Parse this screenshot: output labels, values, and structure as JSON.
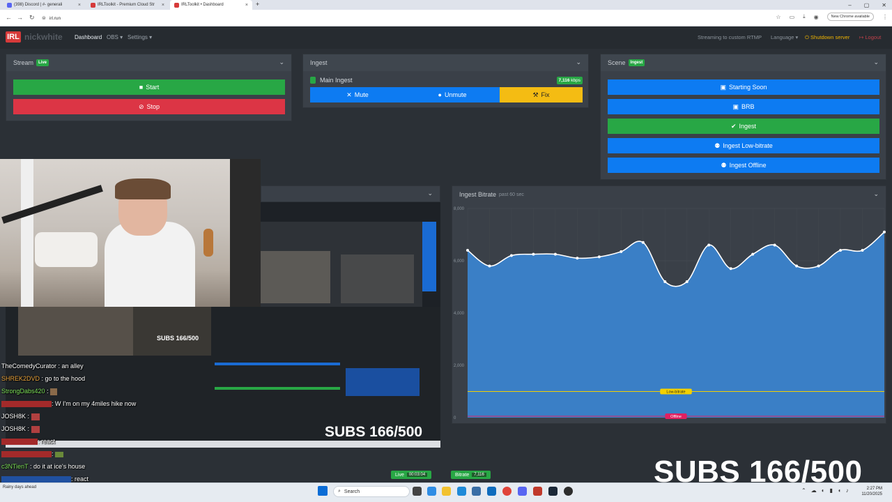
{
  "browser": {
    "tabs": [
      {
        "label": "(398) Discord | #- generali"
      },
      {
        "label": "IRLToolkit - Premium Cloud Str"
      },
      {
        "label": "IRLToolkit • Dashboard"
      }
    ],
    "url": "irl.run",
    "new_chrome": "New Chrome available"
  },
  "app": {
    "brand": "nickwhite",
    "nav": {
      "dashboard": "Dashboard",
      "obs": "OBS",
      "settings": "Settings"
    },
    "status": "Streaming to custom RTMP",
    "language": "Language",
    "shutdown": "Shutdown server",
    "logout": "Logout"
  },
  "stream": {
    "title": "Stream",
    "badge": "Live",
    "start": "Start",
    "stop": "Stop"
  },
  "ingest": {
    "title": "Ingest",
    "source": "Main Ingest",
    "bitrate": "7,116",
    "unit": "kbps",
    "mute": "Mute",
    "unmute": "Unmute",
    "fix": "Fix"
  },
  "scene": {
    "title": "Scene",
    "badge": "Ingest",
    "buttons": [
      "Starting Soon",
      "BRB",
      "Ingest",
      "Ingest Low-bitrate",
      "Ingest Offline"
    ]
  },
  "chart": {
    "title": "Ingest Bitrate",
    "subtitle": "past 60 sec",
    "low_label": "Low-bitrate",
    "offline_label": "Offline"
  },
  "chart_data": {
    "type": "area",
    "title": "Ingest Bitrate",
    "subtitle": "past 60 sec",
    "yticks": [
      "8,000",
      "6,000",
      "4,000",
      "2,000",
      "0"
    ],
    "ylim": [
      0,
      8000
    ],
    "values": [
      6400,
      5800,
      6200,
      6250,
      6250,
      6100,
      6150,
      6350,
      6700,
      5200,
      5200,
      6600,
      5700,
      6250,
      6600,
      5800,
      5800,
      6400,
      6400,
      7100
    ],
    "thresholds": [
      {
        "name": "Low-bitrate",
        "value": 1000,
        "color": "#f4d000"
      },
      {
        "name": "Offline",
        "value": 0,
        "color": "#e02060"
      }
    ],
    "grid": true
  },
  "footer": {
    "live_label": "Live",
    "live_time": "00:03:04",
    "bitrate_label": "Bitrate",
    "bitrate_value": "7,116"
  },
  "overlay": {
    "subs": "SUBS 166/500"
  },
  "chat": [
    {
      "user": "TheComedyCurator",
      "msg": ": an alley"
    },
    {
      "user": "SHREK2DVD",
      "msg": ": go to the hood"
    },
    {
      "user": "StrongDabs420",
      "msg": ":"
    },
    {
      "user": "",
      "msg": ": W I'm on my 4miles hike now"
    },
    {
      "user": "JOSH8K",
      "msg": ":"
    },
    {
      "user": "JOSH8K",
      "msg": ":"
    },
    {
      "user": "",
      "msg": ": react"
    },
    {
      "user": "",
      "msg": ":"
    },
    {
      "user": "c3NTienT",
      "msg": ": do it at ice's house"
    },
    {
      "user": "",
      "msg": ": react"
    }
  ],
  "taskbar": {
    "search": "Search",
    "weather": "Rainy days ahead",
    "time": "2:27 PM",
    "date": "11/20/2025"
  }
}
